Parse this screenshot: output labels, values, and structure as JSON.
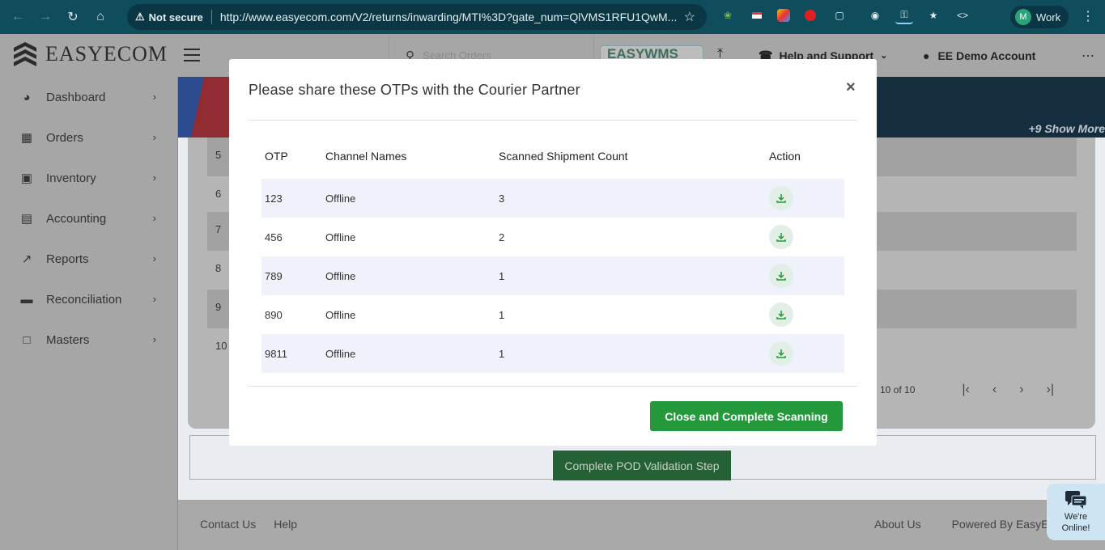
{
  "browser": {
    "security_label": "Not secure",
    "url": "http://www.easyecom.com/V2/returns/inwarding/MTI%3D?gate_num=QlVMS1RFU1QwM...",
    "profile_initial": "M",
    "profile_label": "Work"
  },
  "header": {
    "logo_text": "EASYECOM",
    "search_placeholder": "Search Orders",
    "wms_badge": "EASYWMS",
    "help_label": "Help and Support",
    "account_label": "EE Demo Account"
  },
  "sidebar": {
    "items": [
      {
        "label": "Dashboard",
        "icon": "dashboard-icon"
      },
      {
        "label": "Orders",
        "icon": "grid-icon"
      },
      {
        "label": "Inventory",
        "icon": "bag-icon"
      },
      {
        "label": "Accounting",
        "icon": "ledger-icon"
      },
      {
        "label": "Reports",
        "icon": "chart-icon"
      },
      {
        "label": "Reconciliation",
        "icon": "wallet-icon"
      },
      {
        "label": "Masters",
        "icon": "note-icon"
      }
    ]
  },
  "background": {
    "show_more": "+9 Show More",
    "row_numbers": [
      "5",
      "6",
      "7",
      "8",
      "9",
      "10"
    ],
    "pager_text": "10 of 10",
    "pod_button": "Complete POD Validation Step",
    "footer_links": [
      "Contact Us",
      "Help"
    ],
    "footer_right": [
      "About Us",
      "Powered By EasyEc"
    ]
  },
  "modal": {
    "title": "Please share these OTPs with the Courier Partner",
    "columns": [
      "OTP",
      "Channel Names",
      "Scanned Shipment Count",
      "Action"
    ],
    "rows": [
      {
        "otp": "123",
        "channel": "Offline",
        "count": "3"
      },
      {
        "otp": "456",
        "channel": "Offline",
        "count": "2"
      },
      {
        "otp": "789",
        "channel": "Offline",
        "count": "1"
      },
      {
        "otp": "890",
        "channel": "Offline",
        "count": "1"
      },
      {
        "otp": "9811",
        "channel": "Offline",
        "count": "1"
      }
    ],
    "complete_button": "Close and Complete Scanning"
  },
  "chat": {
    "line1": "We're",
    "line2": "Online!"
  },
  "colors": {
    "primary_green": "#23993c",
    "chrome_bg": "#0f4c5c",
    "row_alt": "#f0f2fb"
  }
}
